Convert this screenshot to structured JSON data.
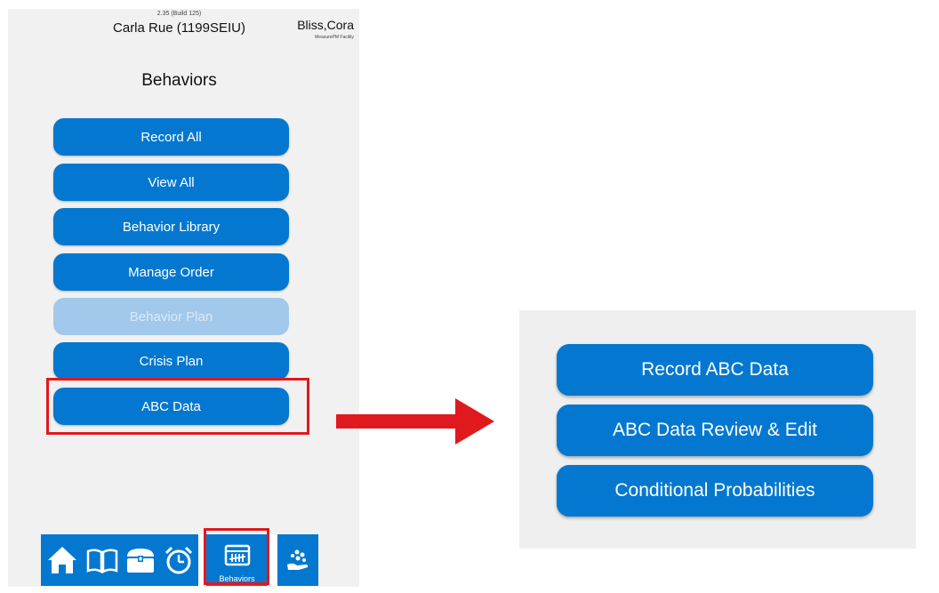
{
  "header": {
    "version": "2.35 (Build 125)",
    "staff_name": "Carla Rue (1199SEIU)",
    "client_name": "Bliss,Cora",
    "facility": "MeasurePM Facility"
  },
  "page": {
    "title": "Behaviors"
  },
  "menu": {
    "items": [
      {
        "label": "Record All",
        "enabled": true
      },
      {
        "label": "View All",
        "enabled": true
      },
      {
        "label": "Behavior Library",
        "enabled": true
      },
      {
        "label": "Manage Order",
        "enabled": true
      },
      {
        "label": "Behavior Plan",
        "enabled": false
      },
      {
        "label": "Crisis Plan",
        "enabled": true
      },
      {
        "label": "ABC Data",
        "enabled": true
      }
    ]
  },
  "bottom_nav": {
    "items": [
      {
        "icon": "home-icon"
      },
      {
        "icon": "book-icon"
      },
      {
        "icon": "chest-icon"
      },
      {
        "icon": "alarm-clock-icon"
      },
      {
        "icon": "behaviors-icon",
        "label": "Behaviors",
        "active": true
      },
      {
        "icon": "hand-dots-icon"
      }
    ]
  },
  "submenu": {
    "items": [
      {
        "label": "Record ABC Data"
      },
      {
        "label": "ABC Data Review & Edit"
      },
      {
        "label": "Conditional Probabilities"
      }
    ]
  },
  "colors": {
    "primary": "#0478d0",
    "disabled": "#a2c9ec",
    "highlight": "#e0191f"
  }
}
